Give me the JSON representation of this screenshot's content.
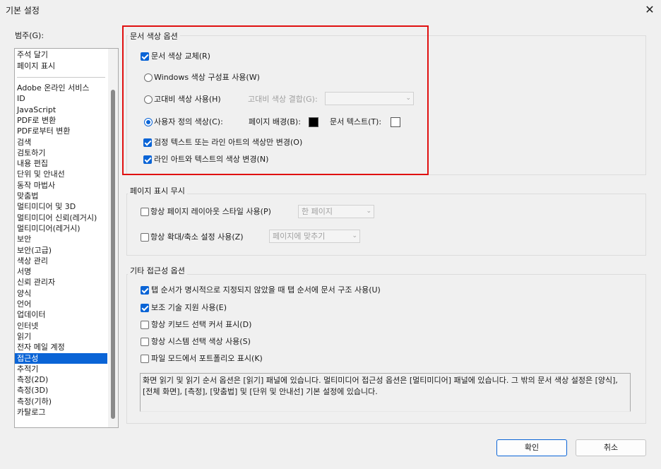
{
  "window": {
    "title": "기본 설정",
    "close_icon": "close-icon"
  },
  "categories": {
    "label": "범주(G):",
    "top_items": [
      "주석 달기",
      "페이지 표시"
    ],
    "items": [
      "Adobe 온라인 서비스",
      "ID",
      "JavaScript",
      "PDF로 변환",
      "PDF로부터 변환",
      "검색",
      "검토하기",
      "내용 편집",
      "단위 및 안내선",
      "동작 마법사",
      "맞춤법",
      "멀티미디어 및 3D",
      "멀티미디어 신뢰(레거시)",
      "멀티미디어(레거시)",
      "보안",
      "보안(고급)",
      "색상 관리",
      "서명",
      "신뢰 관리자",
      "양식",
      "언어",
      "업데이터",
      "인터넷",
      "읽기",
      "전자 메일 계정",
      "접근성",
      "추적기",
      "측정(2D)",
      "측정(3D)",
      "측정(기하)",
      "카탈로그"
    ],
    "selected": "접근성"
  },
  "doc_color": {
    "title": "문서 색상 옵션",
    "replace_label": "문서 색상 교체(R)",
    "windows_label": "Windows 색상 구성표 사용(W)",
    "hc_label": "고대비 색상 사용(H)",
    "hc_combo_label": "고대비 색상 결합(G):",
    "hc_combo_value": "",
    "custom_label": "사용자 정의 색상(C):",
    "page_bg_label": "페이지 배경(B):",
    "page_bg_color": "#000000",
    "doc_text_label": "문서 텍스트(T):",
    "doc_text_color": "#ffffff",
    "black_text_label": "검정 텍스트 또는 라인 아트의 색상만 변경(O)",
    "line_art_label": "라인 아트와 텍스트의 색상 변경(N)",
    "highlight_color": "#e01010"
  },
  "page_display": {
    "title": "페이지 표시 무시",
    "layout_label": "항상 페이지 레이아웃 스타일 사용(P)",
    "layout_value": "한 페이지",
    "zoom_label": "항상 확대/축소 설정 사용(Z)",
    "zoom_value": "페이지에 맞추기"
  },
  "other": {
    "title": "기타 접근성 옵션",
    "tab_order_label": "탭 순서가 명시적으로 지정되지 않았을 때 탭 순서에 문서 구조 사용(U)",
    "assistive_label": "보조 기술 지원 사용(E)",
    "keyboard_label": "항상 키보드 선택 커서 표시(D)",
    "system_color_label": "항상 시스템 선택 색상 사용(S)",
    "portfolio_label": "파일 모드에서 포트폴리오 표시(K)",
    "description": "화면 읽기 및 읽기 순서 옵션은 [읽기] 패널에 있습니다. 멀티미디어 접근성 옵션은 [멀티미디어] 패널에 있습니다. 그 밖의 문서 색상 설정은 [양식], [전체 화면], [측정], [맞춤법] 및 [단위 및 안내선] 기본 설정에 있습니다."
  },
  "buttons": {
    "ok": "확인",
    "cancel": "취소"
  },
  "accent_color": "#0a64d6"
}
